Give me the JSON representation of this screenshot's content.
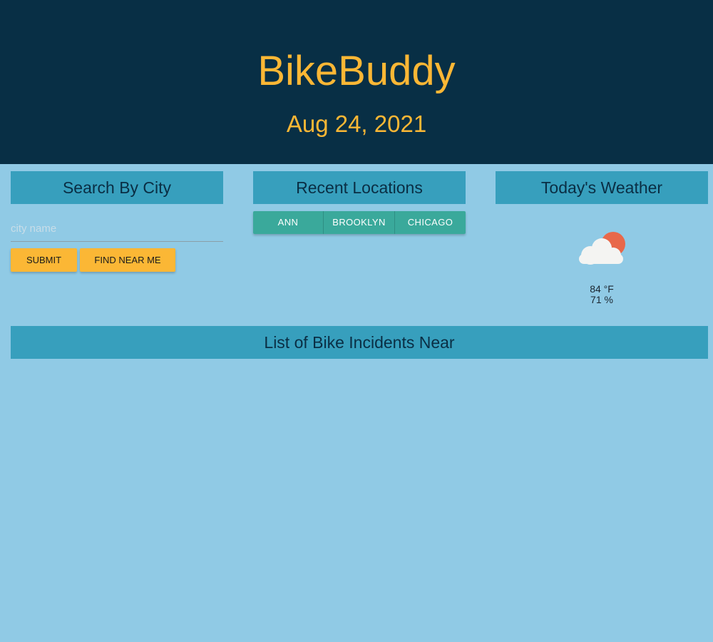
{
  "header": {
    "title": "BikeBuddy",
    "date": "Aug 24, 2021"
  },
  "search": {
    "heading": "Search By City",
    "placeholder": "city name",
    "value": "",
    "submit_label": "SUBMIT",
    "find_near_label": "FIND NEAR ME"
  },
  "recent": {
    "heading": "Recent Locations",
    "locations": [
      "ANN",
      "BROOKLYN",
      "CHICAGO"
    ]
  },
  "weather": {
    "heading": "Today's Weather",
    "icon": "partly-cloudy-icon",
    "temperature": "84 °F",
    "humidity": "71 %"
  },
  "incidents": {
    "heading": "List of Bike Incidents Near"
  },
  "colors": {
    "background": "#90cae5",
    "header_bg": "#082f45",
    "accent_yellow": "#fbb735",
    "panel_heading_bg": "#379fbd",
    "location_button": "#3aa99b"
  }
}
